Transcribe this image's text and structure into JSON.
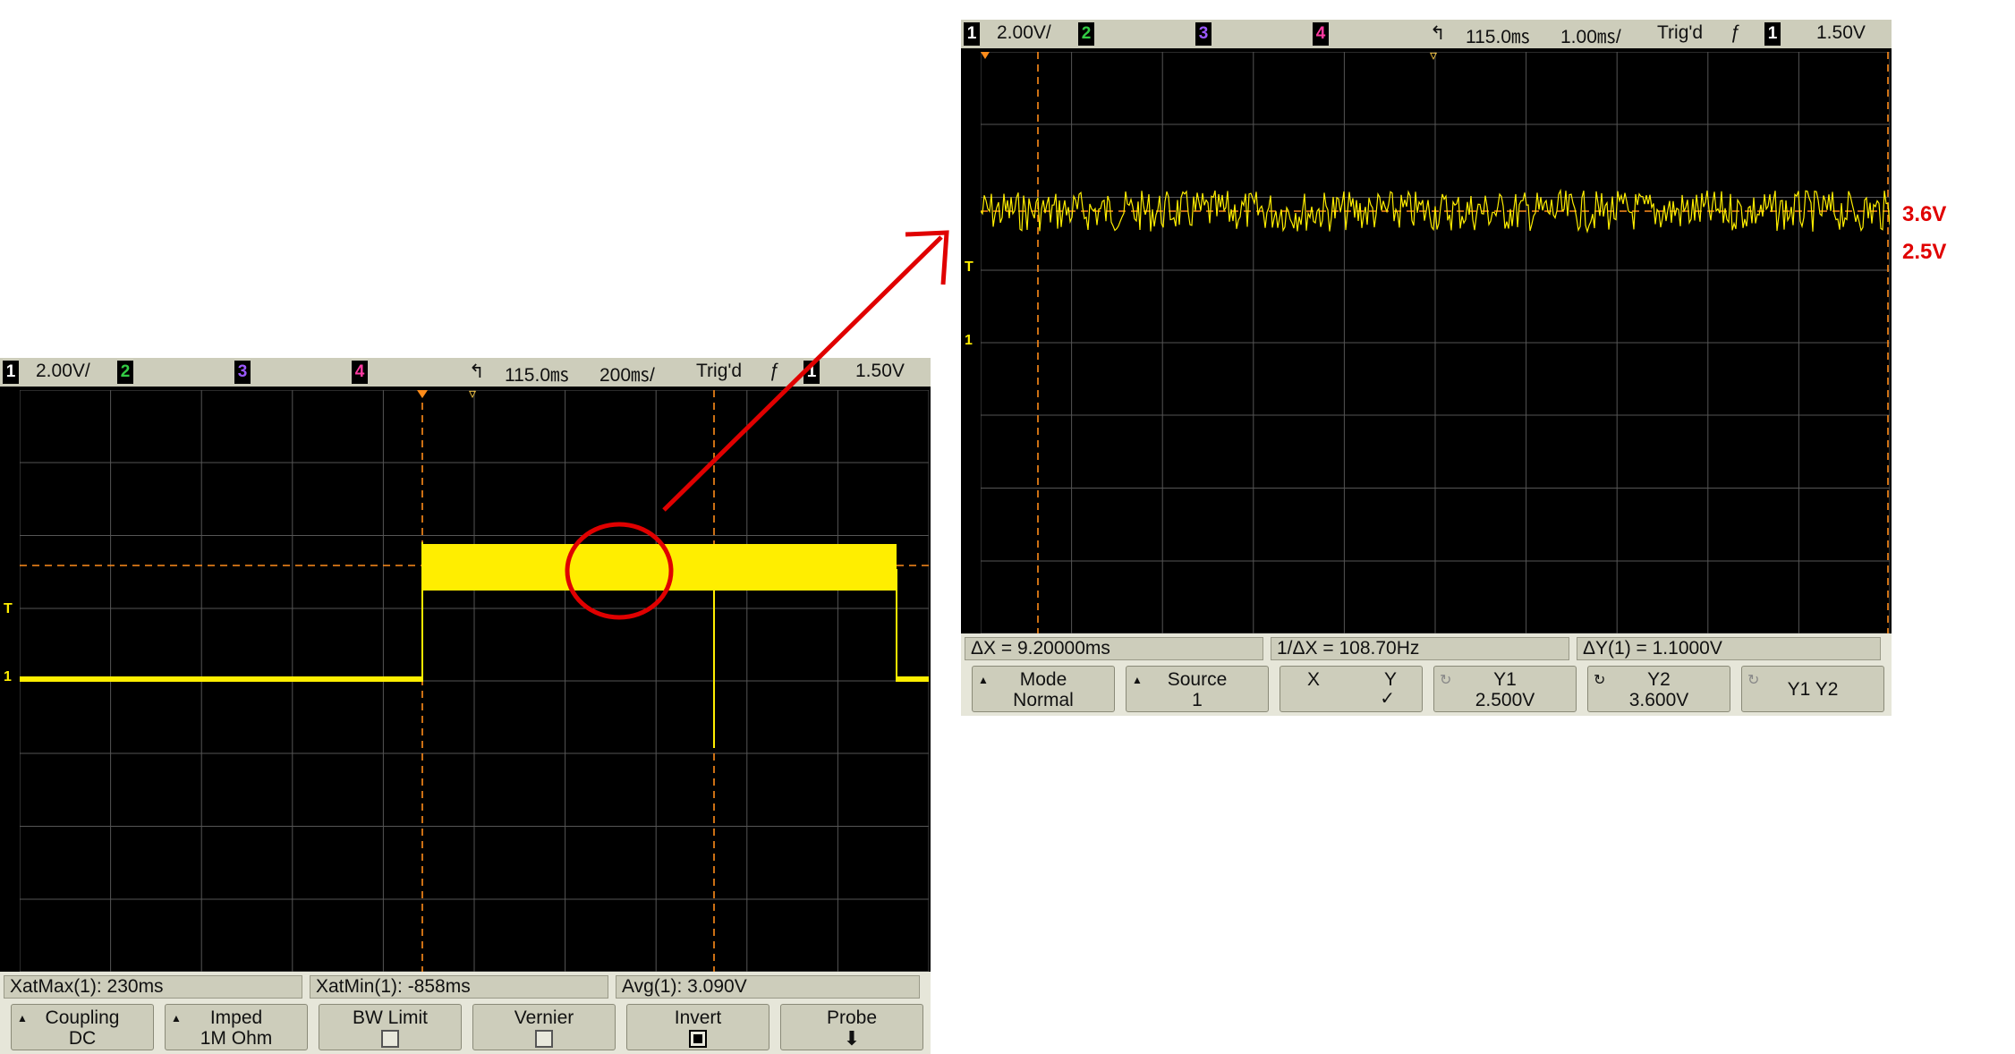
{
  "left_scope": {
    "status": {
      "ch1": "1",
      "ch1_scale": "2.00V/",
      "ch2": "2",
      "ch3": "3",
      "ch4": "4",
      "delay": "115.0㎳",
      "timebase": "200㎳/",
      "trig_state": "Trig'd",
      "trig_slope": "ƒ",
      "trig_src": "1",
      "trig_level": "1.50V"
    },
    "markers": {
      "trigger": "T",
      "ground": "1"
    },
    "measurements": [
      "XatMax(1): 230ms",
      "XatMin(1): -858ms",
      "Avg(1): 3.090V"
    ],
    "softkeys": [
      {
        "label": "Coupling",
        "value": "DC"
      },
      {
        "label": "Imped",
        "value": "1M Ohm"
      },
      {
        "label": "BW Limit",
        "value": ""
      },
      {
        "label": "Vernier",
        "value": ""
      },
      {
        "label": "Invert",
        "value": ""
      },
      {
        "label": "Probe",
        "value": ""
      }
    ]
  },
  "right_scope": {
    "status": {
      "ch1": "1",
      "ch1_scale": "2.00V/",
      "ch2": "2",
      "ch3": "3",
      "ch4": "4",
      "delay": "115.0㎳",
      "timebase": "1.00㎳/",
      "trig_state": "Trig'd",
      "trig_slope": "ƒ",
      "trig_src": "1",
      "trig_level": "1.50V"
    },
    "markers": {
      "trigger": "T",
      "ground": "1"
    },
    "measurements": [
      "ΔX = 9.20000ms",
      "1/ΔX = 108.70Hz",
      "ΔY(1) = 1.1000V"
    ],
    "softkeys": [
      {
        "label": "Mode",
        "value": "Normal"
      },
      {
        "label": "Source",
        "value": "1"
      },
      {
        "label": "X",
        "value": "Y"
      },
      {
        "label": "Y1",
        "value": "2.500V"
      },
      {
        "label": "Y2",
        "value": "3.600V"
      },
      {
        "label": "Y1 Y2",
        "value": ""
      }
    ]
  },
  "annotations": {
    "upper_level": "3.6V",
    "lower_level": "2.5V"
  },
  "colors": {
    "trace": "#ffee00",
    "cursor": "#ff8c1a",
    "annotation": "#e00000",
    "grid": "#555555"
  }
}
